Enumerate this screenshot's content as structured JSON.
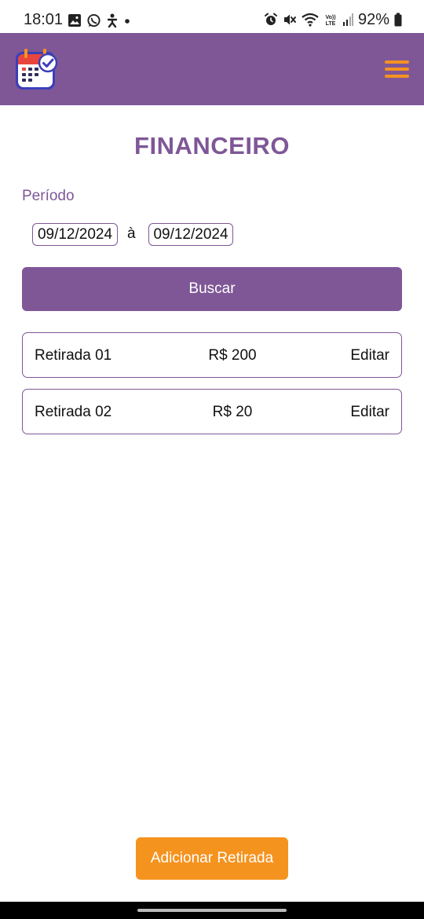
{
  "status_bar": {
    "time": "18:01",
    "battery": "92%",
    "icons_left": [
      "gallery-icon",
      "whatsapp-icon",
      "accessibility-icon",
      "dot-icon"
    ],
    "icons_right": [
      "alarm-icon",
      "mute-icon",
      "wifi-icon",
      "volte-icon",
      "signal-icon",
      "battery-icon"
    ]
  },
  "header": {
    "logo": "calendar-check-icon",
    "menu": "hamburger-menu-icon",
    "colors": {
      "background": "#7f5797",
      "menu": "#f5931f"
    }
  },
  "page": {
    "title": "FINANCEIRO",
    "period_label": "Período",
    "date_start": "09/12/2024",
    "date_separator": "à",
    "date_end": "09/12/2024",
    "search_label": "Buscar"
  },
  "entries": [
    {
      "name": "Retirada 01",
      "value": "R$ 200",
      "action": "Editar"
    },
    {
      "name": "Retirada 02",
      "value": "R$ 20",
      "action": "Editar"
    }
  ],
  "footer": {
    "add_label": "Adicionar Retirada",
    "colors": {
      "add_button": "#f5931f"
    }
  }
}
